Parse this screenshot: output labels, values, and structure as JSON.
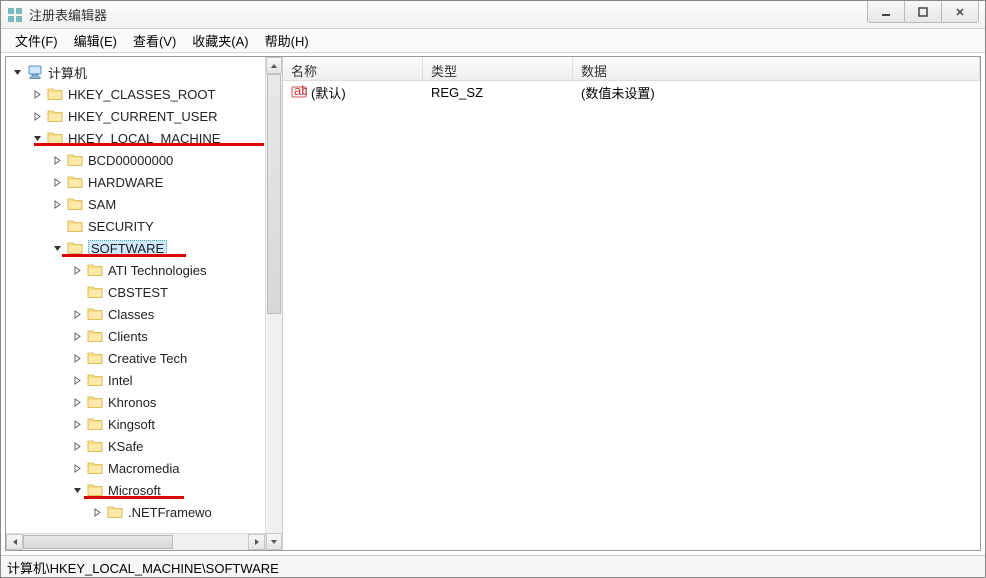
{
  "window": {
    "title": "注册表编辑器"
  },
  "menu": {
    "file": "文件(F)",
    "edit": "编辑(E)",
    "view": "查看(V)",
    "favorites": "收藏夹(A)",
    "help": "帮助(H)"
  },
  "tree": {
    "root": "计算机",
    "hkcr": "HKEY_CLASSES_ROOT",
    "hkcu": "HKEY_CURRENT_USER",
    "hklm": "HKEY_LOCAL_MACHINE",
    "hklm_children": {
      "bcd": "BCD00000000",
      "hardware": "HARDWARE",
      "sam": "SAM",
      "security": "SECURITY",
      "software": "SOFTWARE"
    },
    "software_children": {
      "ati": "ATI Technologies",
      "cbstest": "CBSTEST",
      "classes": "Classes",
      "clients": "Clients",
      "creative": "Creative Tech",
      "intel": "Intel",
      "khronos": "Khronos",
      "kingsoft": "Kingsoft",
      "ksafe": "KSafe",
      "macromedia": "Macromedia",
      "microsoft": "Microsoft"
    },
    "microsoft_children": {
      "netframework": ".NETFramewo"
    }
  },
  "list": {
    "headers": {
      "name": "名称",
      "type": "类型",
      "data": "数据"
    },
    "rows": [
      {
        "name": "(默认)",
        "type": "REG_SZ",
        "data": "(数值未设置)"
      }
    ]
  },
  "statusbar": "计算机\\HKEY_LOCAL_MACHINE\\SOFTWARE"
}
